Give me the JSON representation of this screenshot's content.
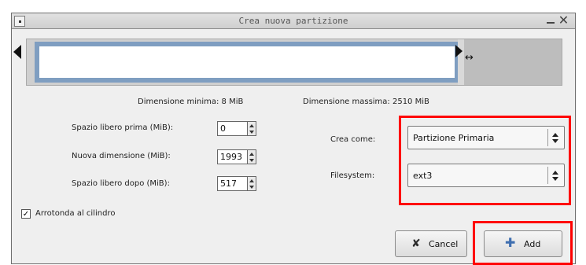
{
  "window": {
    "title": "Crea nuova partizione"
  },
  "sizes": {
    "min_label": "Dimensione minima: 8 MiB",
    "max_label": "Dimensione massima: 2510 MiB"
  },
  "fields": {
    "free_before": {
      "label": "Spazio libero prima (MiB):",
      "value": "0"
    },
    "new_size": {
      "label": "Nuova dimensione (MiB):",
      "value": "1993"
    },
    "free_after": {
      "label": "Spazio libero dopo (MiB):",
      "value": "517"
    }
  },
  "create_as": {
    "label": "Crea come:",
    "value": "Partizione Primaria"
  },
  "filesystem": {
    "label": "Filesystem:",
    "value": "ext3"
  },
  "round_cylinder": {
    "label": "Arrotonda al cilindro",
    "checked": true,
    "mark": "✓"
  },
  "buttons": {
    "cancel": {
      "label": "Cancel",
      "icon": "cancel-x-icon"
    },
    "add": {
      "label": "Add",
      "icon": "plus-icon"
    }
  },
  "colors": {
    "partition_border": "#7f9ec1",
    "highlight": "#ff0000",
    "cancel_icon": "#2a2a2a",
    "add_icon": "#3f6fb0"
  }
}
